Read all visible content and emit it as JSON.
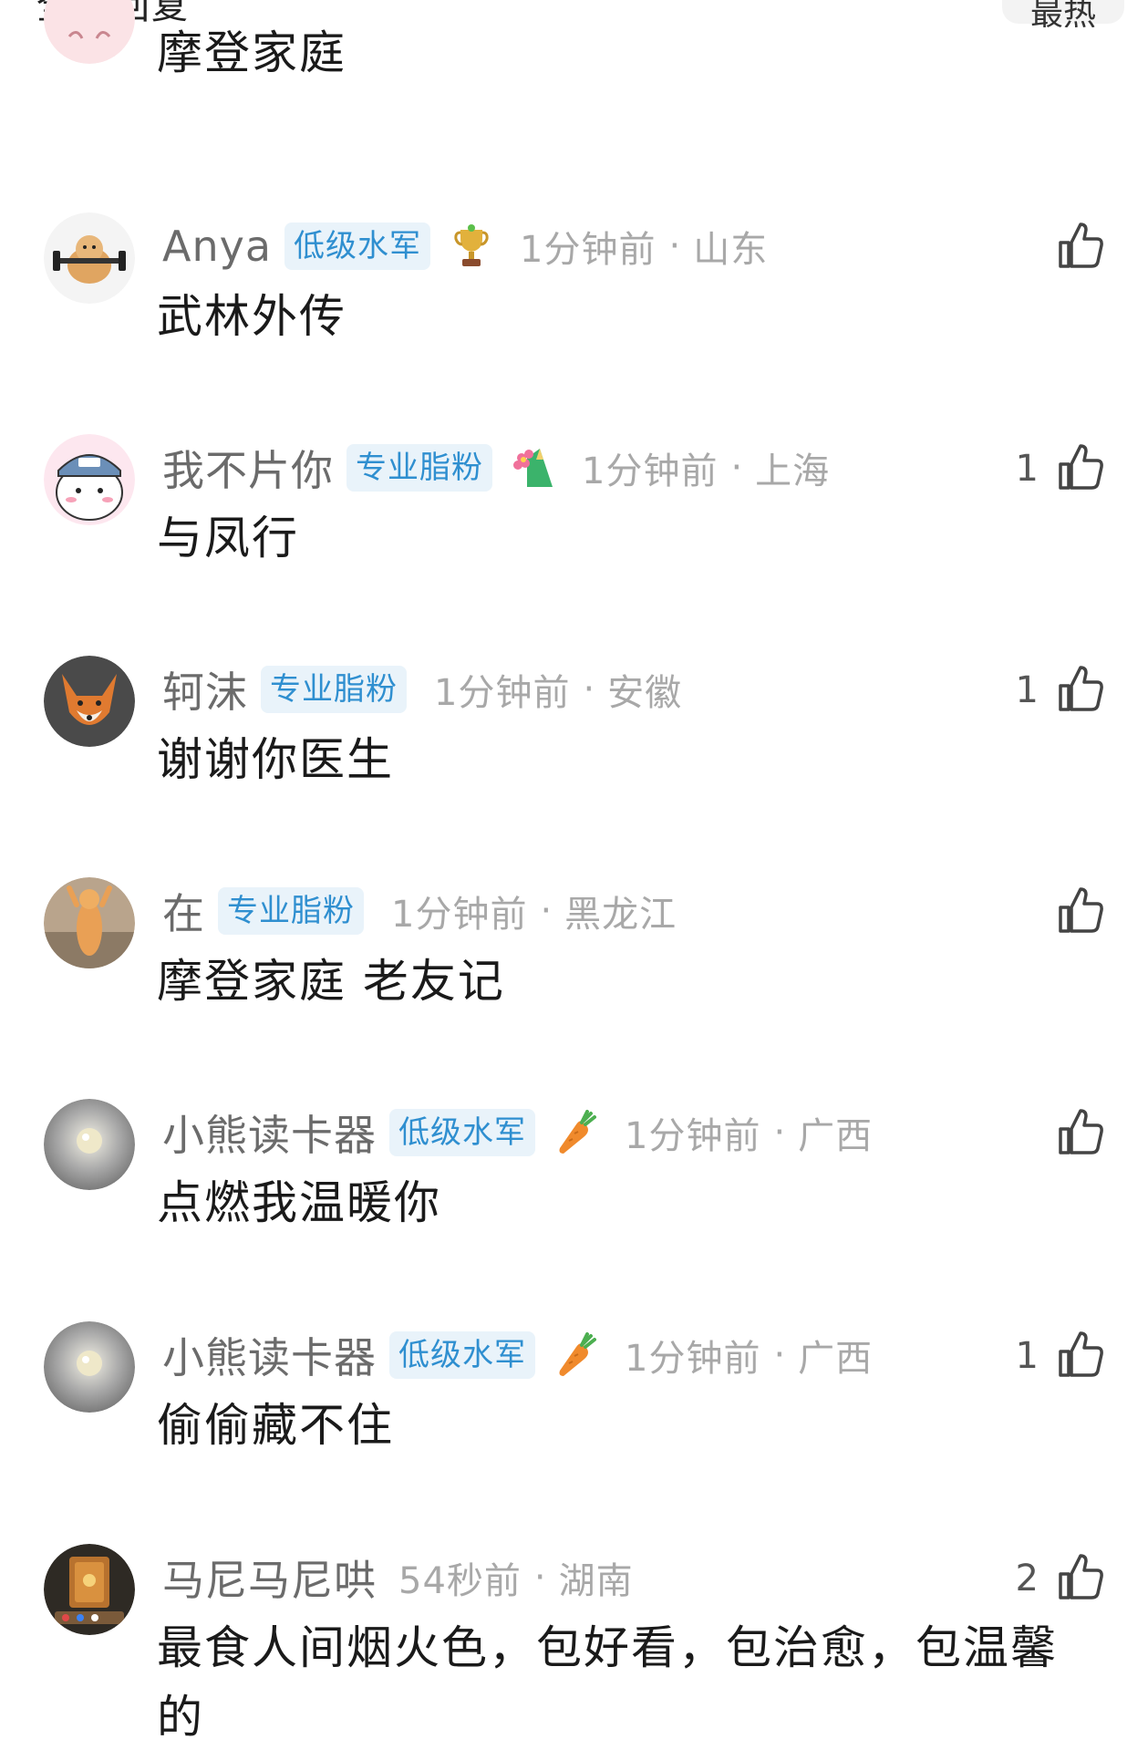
{
  "header": {
    "title": "全部回复",
    "button_label": "最热"
  },
  "comments": [
    {
      "username": "",
      "badge": "",
      "medal_icon": "",
      "time": "",
      "location": "",
      "likes": "",
      "content": "摩登家庭",
      "avatar_icon": "pink-character-avatar"
    },
    {
      "username": "Anya",
      "badge": "低级水军",
      "medal_icon": "trophy-icon",
      "time": "1分钟前",
      "location": "山东",
      "likes": "",
      "content": "武林外传",
      "avatar_icon": "hamster-avatar"
    },
    {
      "username": "我不片你",
      "badge": "专业脂粉",
      "medal_icon": "flower-pencil-icon",
      "time": "1分钟前",
      "location": "上海",
      "likes": "1",
      "content": "与凤行",
      "avatar_icon": "chiikawa-avatar"
    },
    {
      "username": "轲沫",
      "badge": "专业脂粉",
      "medal_icon": "",
      "time": "1分钟前",
      "location": "安徽",
      "likes": "1",
      "content": "谢谢你医生",
      "avatar_icon": "fox-avatar"
    },
    {
      "username": "在",
      "badge": "专业脂粉",
      "medal_icon": "",
      "time": "1分钟前",
      "location": "黑龙江",
      "likes": "",
      "content": "摩登家庭 老友记",
      "avatar_icon": "cat-avatar"
    },
    {
      "username": "小熊读卡器",
      "badge": "低级水军",
      "medal_icon": "carrot-icon",
      "time": "1分钟前",
      "location": "广西",
      "likes": "",
      "content": "点燃我温暖你",
      "avatar_icon": "pearl-avatar"
    },
    {
      "username": "小熊读卡器",
      "badge": "低级水军",
      "medal_icon": "carrot-icon",
      "time": "1分钟前",
      "location": "广西",
      "likes": "1",
      "content": "偷偷藏不住",
      "avatar_icon": "pearl-avatar"
    },
    {
      "username": "马尼马尼哄",
      "badge": "",
      "medal_icon": "",
      "time": "54秒前",
      "location": "湖南",
      "likes": "2",
      "content": "最食人间烟火色，包好看，包治愈，包温馨的",
      "avatar_icon": "card-avatar"
    }
  ],
  "icons": {
    "like": "thumbs-up-icon"
  }
}
